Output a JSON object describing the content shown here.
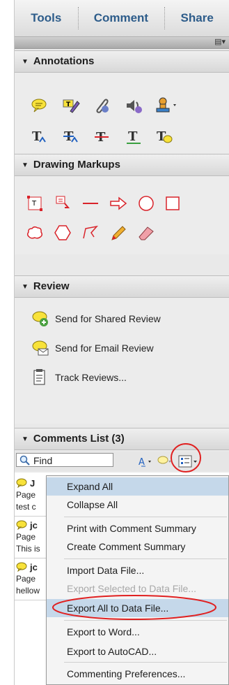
{
  "tabs": [
    "Tools",
    "Comment",
    "Share"
  ],
  "sections": {
    "annotations": "Annotations",
    "drawing": "Drawing Markups",
    "review": "Review",
    "comments": "Comments List (3)"
  },
  "review_items": [
    "Send for Shared Review",
    "Send for Email Review",
    "Track Reviews..."
  ],
  "find_placeholder": "Find",
  "comments": [
    {
      "author_fragment": "J",
      "line1": "Page",
      "line2": "test c"
    },
    {
      "author_fragment": "jc",
      "line1": "Page",
      "line2": "This is"
    },
    {
      "author_fragment": "jc",
      "line1": "Page",
      "line2": "hellow"
    }
  ],
  "menu": {
    "items": [
      {
        "label": "Expand All",
        "highlighted": true,
        "disabled": false
      },
      {
        "label": "Collapse All",
        "highlighted": false,
        "disabled": false
      },
      {
        "label": "Print with Comment Summary",
        "highlighted": false,
        "disabled": false
      },
      {
        "label": "Create Comment Summary",
        "highlighted": false,
        "disabled": false
      },
      {
        "label": "Import Data File...",
        "highlighted": false,
        "disabled": false
      },
      {
        "label": "Export Selected to Data File...",
        "highlighted": false,
        "disabled": true
      },
      {
        "label": "Export All to Data File...",
        "highlighted": true,
        "disabled": false
      },
      {
        "label": "Export to Word...",
        "highlighted": false,
        "disabled": false
      },
      {
        "label": "Export to AutoCAD...",
        "highlighted": false,
        "disabled": false
      },
      {
        "label": "Commenting Preferences...",
        "highlighted": false,
        "disabled": false
      }
    ]
  },
  "colors": {
    "tab_text": "#2d5c8a",
    "highlight": "#c5d8ea",
    "circle": "#e02020",
    "markup_red": "#d9232a"
  }
}
